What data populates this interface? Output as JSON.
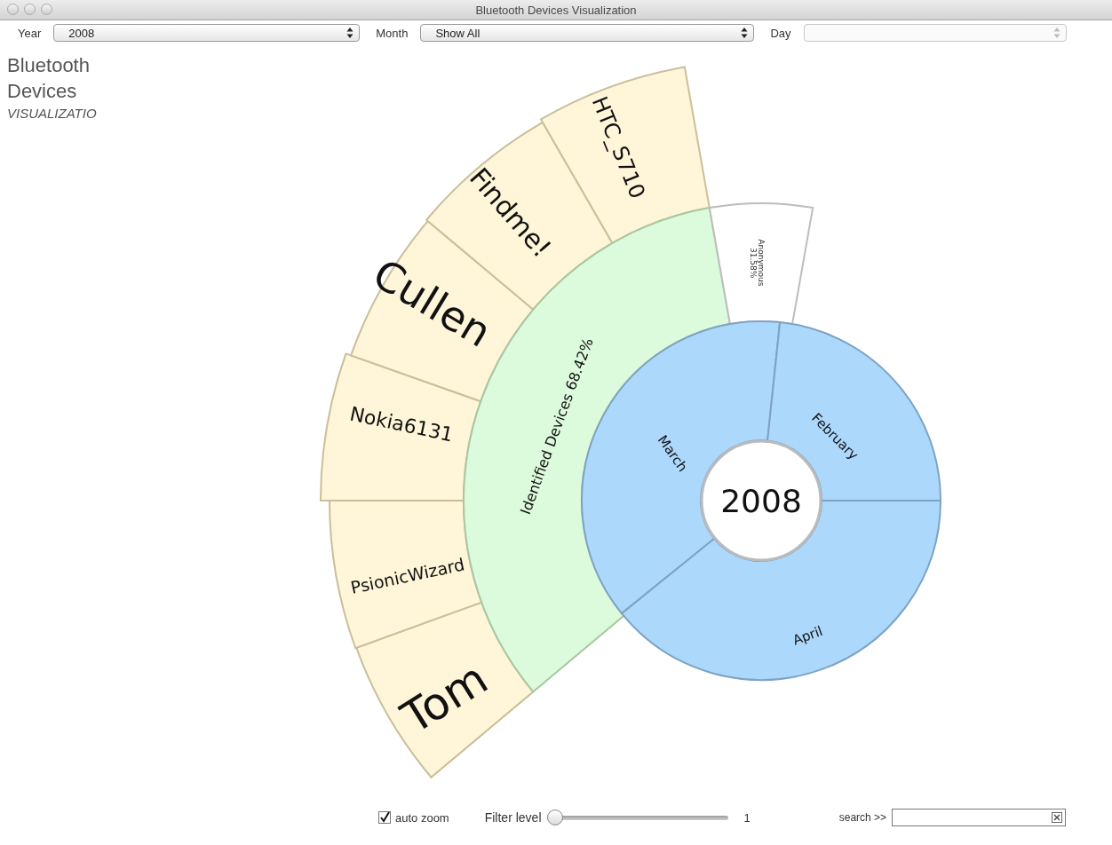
{
  "window": {
    "title": "Bluetooth Devices Visualization"
  },
  "filters": [
    {
      "label": "Year",
      "value": "2008",
      "disabled": false
    },
    {
      "label": "Month",
      "value": "Show All",
      "disabled": false
    },
    {
      "label": "Day",
      "disabled": true
    }
  ],
  "heading": {
    "title": "Bluetooth Devices",
    "subtitle": "VISUALIZATIO"
  },
  "sunburst": {
    "center": "2008",
    "months": [
      {
        "label": "March"
      },
      {
        "label": "February"
      },
      {
        "label": "April"
      }
    ],
    "groups": [
      {
        "kind": "identified",
        "label": "Identified Devices 68.42%"
      },
      {
        "kind": "anonymous",
        "label": "Anonymous",
        "share": "31.58%"
      }
    ],
    "devices": [
      {
        "label": "Tom"
      },
      {
        "label": "PsionicWizard"
      },
      {
        "label": "Nokia6131"
      },
      {
        "label": "Cullen"
      },
      {
        "label": "Findme!"
      },
      {
        "label": "HTC_S710"
      }
    ]
  },
  "footer": {
    "auto_zoom": {
      "label": "auto zoom",
      "checked": true
    },
    "filter": {
      "label": "Filter level",
      "level": 0,
      "reading": "1"
    },
    "search": {
      "label": "search >>"
    }
  }
}
